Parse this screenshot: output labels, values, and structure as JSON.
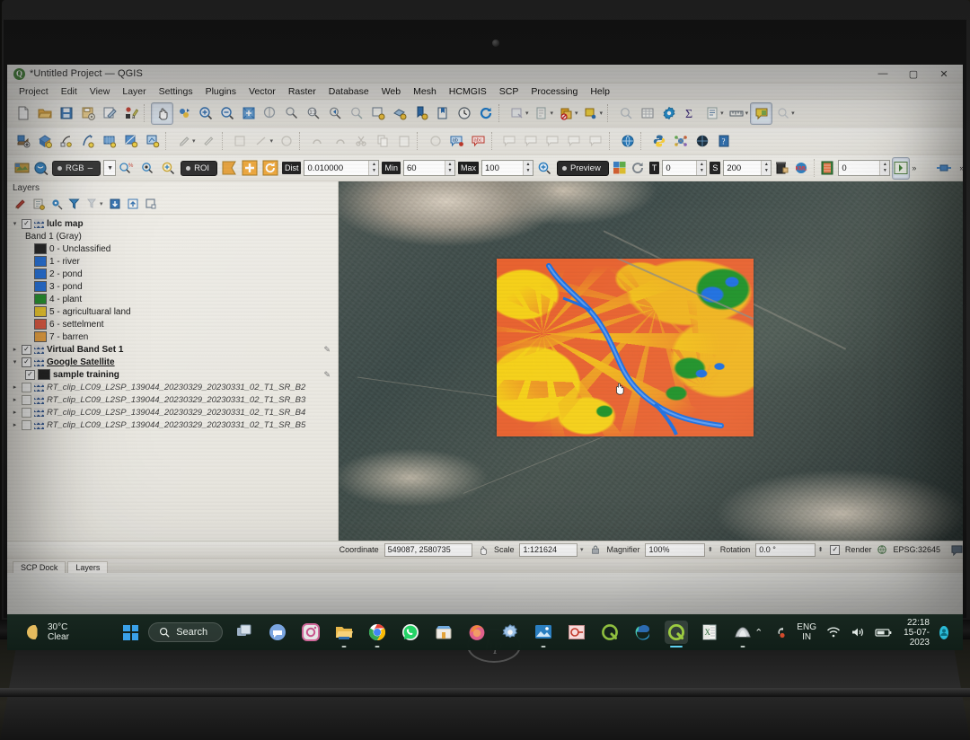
{
  "window": {
    "title": "*Untitled Project — QGIS",
    "app_icon": "qgis-icon",
    "minimize": "—",
    "maximize": "▢",
    "close": "✕"
  },
  "menubar": {
    "items": [
      "Project",
      "Edit",
      "View",
      "Layer",
      "Settings",
      "Plugins",
      "Vector",
      "Raster",
      "Database",
      "Web",
      "Mesh",
      "HCMGIS",
      "SCP",
      "Processing",
      "Help"
    ]
  },
  "toolbar_main": {
    "icons": [
      "new-project-icon",
      "open-project-icon",
      "save-project-icon",
      "save-project-as-icon",
      "new-print-layout-icon",
      "style-manager-icon",
      "pan-map-icon",
      "pan-to-selection-icon",
      "zoom-in-icon",
      "zoom-out-icon",
      "zoom-full-icon",
      "zoom-to-selection-icon",
      "zoom-to-layer-icon",
      "zoom-native-icon",
      "zoom-last-icon",
      "zoom-next-icon",
      "new-map-view-icon",
      "new-3d-view-icon",
      "bookmark-add-icon",
      "bookmark-list-icon",
      "temporal-controller-icon",
      "refresh-icon",
      "identify-features-icon",
      "select-features-icon",
      "deselect-icon",
      "measure-icon",
      "map-tips-icon",
      "statistical-summary-icon",
      "attribute-table-icon",
      "field-calculator-icon",
      "show-map-tips-icon",
      "text-annotation-icon"
    ]
  },
  "toolbar_secondary": {
    "icons": [
      "add-raster-layer-icon",
      "add-delimited-text-icon",
      "add-vector-layer-icon",
      "add-virtual-layer-icon",
      "add-mesh-layer-icon",
      "add-wms-layer-icon",
      "add-wcs-layer-icon",
      "toggle-editing-icon",
      "save-layer-edits-icon",
      "digitize-icon",
      "vertex-tool-icon",
      "modify-attributes-icon",
      "delete-selected-icon",
      "cut-features-icon",
      "copy-features-icon",
      "paste-features-icon",
      "undo-icon",
      "redo-icon",
      "label-toolbar-icon",
      "highlight-pinned-labels-icon",
      "pin-labels-icon",
      "show-hide-labels-icon",
      "move-label-icon",
      "rotate-label-icon",
      "change-label-icon",
      "metasearch-icon",
      "python-console-icon",
      "plugin-manager-icon",
      "georeferencer-icon",
      "help-icon"
    ]
  },
  "scp_toolbar": {
    "band_set_label": "RGB",
    "rgb_combo_value": "",
    "roi_label": "ROI",
    "dist_label": "Dist",
    "dist_value": "0.010000",
    "min_label": "Min",
    "min_value": "60",
    "max_label": "Max",
    "max_value": "100",
    "preview_label": "Preview",
    "t_label": "T",
    "t_value": "0",
    "s_label": "S",
    "s_value": "200",
    "last_spin_value": "0",
    "overflow_label": "»",
    "icons": [
      "scp-dock-icon",
      "band-set-icon",
      "rgb-list-icon",
      "roi-pointer-icon",
      "roi-polygon-icon",
      "zoom-preview-icon",
      "create-roi-icon",
      "plus-roi-icon",
      "redo-roi-icon",
      "preview-zoom-icon",
      "classification-preview-icon",
      "refresh-preview-icon",
      "remove-temp-icon",
      "kml-icon",
      "usgs-icon",
      "next-icon",
      "collapse-icon"
    ]
  },
  "layers_panel": {
    "title": "Layers",
    "tools": [
      "open-layer-styling-icon",
      "add-group-icon",
      "manage-layer-visibility-icon",
      "filter-legend-icon",
      "filter-legend-expression-icon",
      "expand-all-icon",
      "collapse-all-icon",
      "remove-layer-icon"
    ],
    "items": [
      {
        "name": "lulc map",
        "checked": true,
        "expanded": true,
        "style": "bold",
        "icon": "raster-layer-icon"
      },
      {
        "name": "Band 1 (Gray)",
        "checked": null,
        "style": "plain",
        "indent": 1
      },
      {
        "name": "0 - Unclassified",
        "swatch": "#1a1a1a",
        "indent": 2
      },
      {
        "name": "1 - river",
        "swatch": "#1c6ee0",
        "indent": 2
      },
      {
        "name": "2 - pond",
        "swatch": "#1c6ee0",
        "indent": 2
      },
      {
        "name": "3 - pond",
        "swatch": "#1c6ee0",
        "indent": 2
      },
      {
        "name": "4 - plant",
        "swatch": "#1d9127",
        "indent": 2
      },
      {
        "name": "5 - agricultuaral land",
        "swatch": "#f2cb24",
        "indent": 2
      },
      {
        "name": "6 - settelment",
        "swatch": "#e1533a",
        "indent": 2
      },
      {
        "name": "7 - barren",
        "swatch": "#eda13a",
        "indent": 2
      },
      {
        "name": "Virtual Band Set 1",
        "checked": true,
        "expanded": false,
        "style": "bold",
        "icon": "raster-layer-icon"
      },
      {
        "name": "Google Satellite",
        "checked": true,
        "expanded": true,
        "style": "underline",
        "icon": "raster-layer-icon"
      },
      {
        "name": "sample training",
        "checked": true,
        "style": "bold",
        "swatch": "#1a1a1a",
        "indent": 1
      },
      {
        "name": "RT_clip_LC09_L2SP_139044_20230329_20230331_02_T1_SR_B2",
        "checked": false,
        "expanded": false,
        "style": "italic",
        "icon": "raster-layer-icon"
      },
      {
        "name": "RT_clip_LC09_L2SP_139044_20230329_20230331_02_T1_SR_B3",
        "checked": false,
        "expanded": false,
        "style": "italic",
        "icon": "raster-layer-icon"
      },
      {
        "name": "RT_clip_LC09_L2SP_139044_20230329_20230331_02_T1_SR_B4",
        "checked": false,
        "expanded": false,
        "style": "italic",
        "icon": "raster-layer-icon"
      },
      {
        "name": "RT_clip_LC09_L2SP_139044_20230329_20230331_02_T1_SR_B5",
        "checked": false,
        "expanded": false,
        "style": "italic",
        "icon": "raster-layer-icon"
      }
    ]
  },
  "map": {
    "basemap": "Google Satellite",
    "overlay": "lulc classified raster",
    "cursor": "pan-hand-cursor",
    "class_colors": {
      "unclassified": "#1a1a1a",
      "river": "#1c6ee0",
      "pond": "#1c6ee0",
      "plant": "#1d9127",
      "agricultural_land": "#f2cb24",
      "settlement": "#e1533a",
      "barren": "#eda13a"
    }
  },
  "statusbar": {
    "coordinate_label": "Coordinate",
    "coordinate_value": "549087, 2580735",
    "scale_label": "Scale",
    "scale_value": "1:121624",
    "magnifier_label": "Magnifier",
    "magnifier_value": "100%",
    "rotation_label": "Rotation",
    "rotation_value": "0.0 °",
    "render_label": "Render",
    "render_checked": true,
    "crs_label": "EPSG:32645",
    "messages_icon": "message-log-icon"
  },
  "dock_tabs": [
    {
      "label": "SCP Dock",
      "selected": false
    },
    {
      "label": "Layers",
      "selected": true
    }
  ],
  "taskbar": {
    "weather_temp": "30°C",
    "weather_desc": "Clear",
    "start_icon": "windows-start-icon",
    "search_label": "Search",
    "search_icon": "search-icon",
    "apps": [
      {
        "name": "task-view-icon",
        "running": false
      },
      {
        "name": "chat-icon",
        "running": false
      },
      {
        "name": "instagram-icon",
        "running": false
      },
      {
        "name": "file-explorer-icon",
        "running": true
      },
      {
        "name": "chrome-icon",
        "running": true
      },
      {
        "name": "whatsapp-icon",
        "running": false
      },
      {
        "name": "microsoft-store-icon",
        "running": false
      },
      {
        "name": "firefox-icon",
        "running": false
      },
      {
        "name": "settings-icon",
        "running": false
      },
      {
        "name": "photos-icon",
        "running": true
      },
      {
        "name": "paint-icon",
        "running": false
      },
      {
        "name": "qgis-desktop-icon",
        "running": false
      },
      {
        "name": "edge-icon",
        "running": false
      },
      {
        "name": "qgis-active-icon",
        "running": true,
        "active": true
      },
      {
        "name": "excel-icon",
        "running": false
      },
      {
        "name": "snipping-tool-icon",
        "running": true
      }
    ],
    "tray": {
      "chevron_icon": "show-hidden-icons-icon",
      "onedrive_icon": "onedrive-sync-icon",
      "lang_line1": "ENG",
      "lang_line2": "IN",
      "wifi_icon": "wifi-icon",
      "volume_icon": "volume-icon",
      "battery_icon": "battery-icon",
      "time": "22:18",
      "date": "15-07-2023",
      "avatar_icon": "notification-avatar"
    }
  },
  "hardware": {
    "brand": "hp"
  }
}
